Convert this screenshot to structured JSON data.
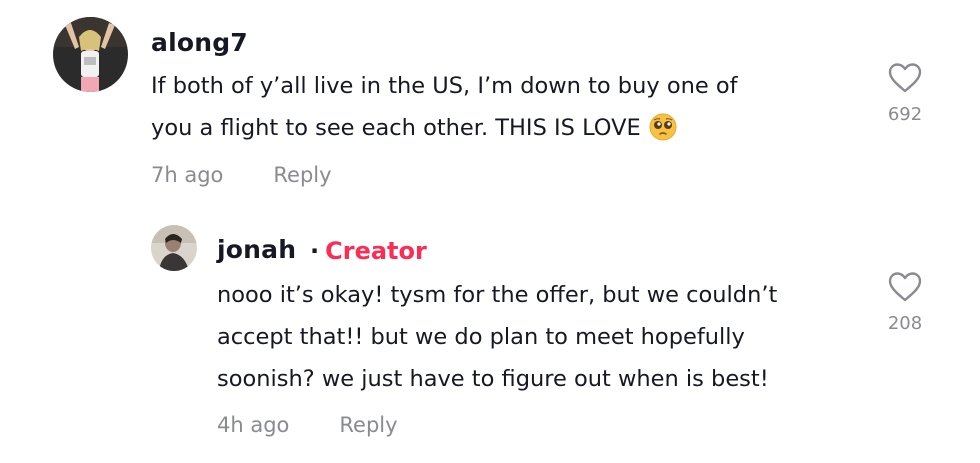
{
  "comments": [
    {
      "username": "along7",
      "lines": [
        "If both of y’all live in the US, I’m down to buy one of",
        "you a flight to see each other. THIS IS LOVE"
      ],
      "emoji": "pleading-face-emoji",
      "time": "7h ago",
      "reply_label": "Reply",
      "like_icon": "heart-outline-icon",
      "like_count": "692"
    },
    {
      "username": "jonah",
      "separator": "·",
      "badge": "Creator",
      "lines": [
        "nooo it’s okay! tysm for the offer, but we couldn’t",
        "accept that!! but we do plan to meet hopefully",
        "soonish? we just have to figure out when is best!"
      ],
      "time": "4h ago",
      "reply_label": "Reply",
      "like_icon": "heart-outline-icon",
      "like_count": "208"
    }
  ],
  "colors": {
    "text": "#161823",
    "muted": "#8a8b91",
    "creator_badge": "#fe2c55"
  }
}
